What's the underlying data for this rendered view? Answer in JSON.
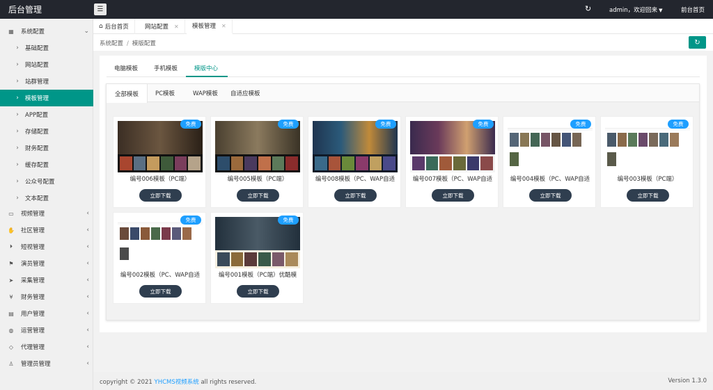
{
  "header": {
    "brand": "后台管理",
    "menu_toggle_icon": "menu-collapse-icon",
    "admin_label": "admin，欢迎回来",
    "front_link": "前台首页"
  },
  "sidebar": {
    "items": [
      {
        "label": "系统配置",
        "icon": "system-icon"
      },
      {
        "label": "基础配置",
        "icon": "chevron-right-icon"
      },
      {
        "label": "网站配置",
        "icon": "chevron-right-icon"
      },
      {
        "label": "站群管理",
        "icon": "chevron-right-icon"
      },
      {
        "label": "模板管理",
        "icon": "chevron-right-icon"
      },
      {
        "label": "APP配置",
        "icon": "chevron-right-icon"
      },
      {
        "label": "存储配置",
        "icon": "chevron-right-icon"
      },
      {
        "label": "财务配置",
        "icon": "chevron-right-icon"
      },
      {
        "label": "缓存配置",
        "icon": "chevron-right-icon"
      },
      {
        "label": "公众号配置",
        "icon": "chevron-right-icon"
      },
      {
        "label": "文本配置",
        "icon": "chevron-right-icon"
      },
      {
        "label": "视频管理",
        "icon": "video-icon"
      },
      {
        "label": "社区管理",
        "icon": "community-icon"
      },
      {
        "label": "短视管理",
        "icon": "play-icon"
      },
      {
        "label": "演员管理",
        "icon": "flag-icon"
      },
      {
        "label": "采集管理",
        "icon": "send-icon"
      },
      {
        "label": "财务管理",
        "icon": "finance-icon"
      },
      {
        "label": "用户管理",
        "icon": "user-card-icon"
      },
      {
        "label": "运营管理",
        "icon": "globe-icon"
      },
      {
        "label": "代理管理",
        "icon": "diamond-icon"
      },
      {
        "label": "管理员管理",
        "icon": "person-icon"
      }
    ]
  },
  "page_tabs": [
    {
      "label": "后台首页"
    },
    {
      "label": "网站配置"
    },
    {
      "label": "模板管理"
    }
  ],
  "breadcrumb": {
    "part1": "系统配置",
    "separator": "/",
    "part2": "模版配置"
  },
  "main_tabs": [
    {
      "label": "电脑模板"
    },
    {
      "label": "手机模板"
    },
    {
      "label": "模版中心"
    }
  ],
  "sub_tabs": [
    {
      "label": "全部模板"
    },
    {
      "label": "PC模板"
    },
    {
      "label": "WAP模板"
    },
    {
      "label": "自适应模板"
    }
  ],
  "templates": [
    {
      "title": "编号006模板（PC端）",
      "badge": "免费",
      "button": "立即下载"
    },
    {
      "title": "编号005模板（PC端）",
      "badge": "免费",
      "button": "立即下载"
    },
    {
      "title": "编号008模板（PC、WAP自适",
      "badge": "免费",
      "button": "立即下载"
    },
    {
      "title": "编号007模板（PC、WAP自适",
      "badge": "免费",
      "button": "立即下载"
    },
    {
      "title": "编号004模板（PC、WAP自适",
      "badge": "免费",
      "button": "立即下载"
    },
    {
      "title": "编号003模板（PC端）",
      "badge": "免费",
      "button": "立即下载"
    },
    {
      "title": "编号002模板（PC、WAP自适",
      "badge": "免费",
      "button": "立即下载"
    },
    {
      "title": "编号001模板（PC端）优酷模",
      "badge": "免费",
      "button": "立即下载"
    }
  ],
  "footer": {
    "copy_prefix": "copyright © 2021 ",
    "copy_brand": "YHCMS视频系统",
    "copy_suffix": " all rights reserved.",
    "version": "Version 1.3.0"
  },
  "colors": {
    "accent": "#009688",
    "topbar": "#23262e",
    "badge": "#1e9fff",
    "button": "#2f3e4f"
  }
}
